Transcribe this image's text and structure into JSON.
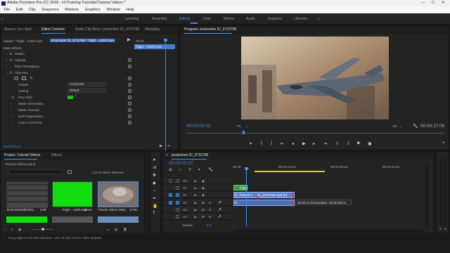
{
  "window": {
    "title": "Adobe Premiere Pro CC 2018 - H:\\Training Tutorials\\Tutorial Videos *",
    "min": "—",
    "max": "☐",
    "close": "✕"
  },
  "menu": [
    "File",
    "Edit",
    "Clip",
    "Sequence",
    "Markers",
    "Graphics",
    "Window",
    "Help"
  ],
  "workspaces": [
    "Learning",
    "Assembly",
    "Editing",
    "Color",
    "Effects",
    "Audio",
    "Graphics",
    "Libraries"
  ],
  "source_panel": {
    "tabs": [
      "Source: (no clips)",
      "Effect Controls",
      "Audio Clip Mixer: production ID_3715798",
      "Metadata"
    ],
    "path": "Master * Flight - 1400l.mp4",
    "clip": "production ID_3715798 * Flight - 1400l.mp4",
    "mini_clip": "Flight - 1400l.mp4",
    "mini_time": "00:00",
    "section": "Video Effects",
    "rows": [
      "Motion",
      "Opacity",
      "Time Remapping",
      "Ultra Key"
    ],
    "output_label": "Output",
    "output_value": "Composite",
    "setting_label": "Setting",
    "setting_value": "Default",
    "keycolor_label": "Key Color",
    "key_color": "#1ec21e",
    "sub": [
      "Matte Generation",
      "Matte Cleanup",
      "Spill Suppression",
      "Color Correction"
    ],
    "timecode": "00:00:03:22"
  },
  "program_panel": {
    "title": "Program: production ID_3715798",
    "timecode": "00:00:03:22",
    "fit": "Fit",
    "fraction": "1/4",
    "duration": "00:00:17:06"
  },
  "project_panel": {
    "tabs": [
      "Project: Tutorial Videos",
      "Effects"
    ],
    "file": "Tutorial Videos.prproj",
    "count": "1 of 12 items selected",
    "items": [
      {
        "name": "brick-brickwall-brick...",
        "dur": "4:29",
        "bg": "#3a3a3a"
      },
      {
        "name": "Flight - 1400l.mp4",
        "dur": "10:01",
        "bg": "#11dd11"
      },
      {
        "name": "Pexels Videos 2016...",
        "dur": "17:06",
        "bg": "#6a5a55"
      }
    ]
  },
  "timeline": {
    "title": "production ID_3715798",
    "timecode": "00:00:03:22",
    "ruler": [
      "00:00",
      "00:00:14:23",
      "00:00:29:23",
      "00:00:44:22"
    ],
    "tracks": [
      "V3",
      "V2",
      "V1",
      "A1",
      "A2",
      "A3"
    ],
    "master": "Master",
    "master_val": "0.0",
    "clip_flight": "Flight",
    "clip_main": "Pexels V",
    "clip_fx": "fx",
    "clip_main_rest": "ID_3715798.mp4 [V]",
    "tooltip": "00:00:11:03 Duration: 00:00:05:01",
    "audio_fx": "fx"
  },
  "status": "Drag edge to trim the selection. Use Alt and Ctrl for other options."
}
